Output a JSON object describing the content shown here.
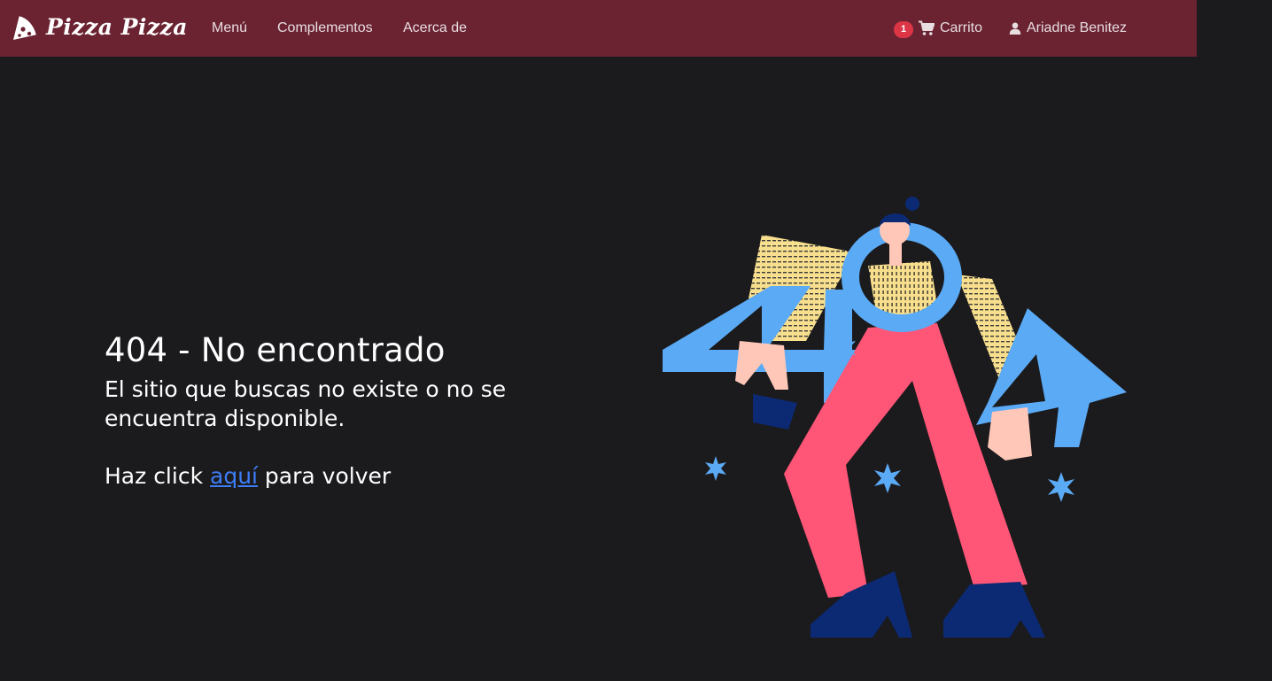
{
  "navbar": {
    "brand": "Pizza Pizza",
    "links": [
      "Menú",
      "Complementos",
      "Acerca de"
    ],
    "cart": {
      "count": "1",
      "label": "Carrito"
    },
    "user": {
      "name": "Ariadne Benitez"
    }
  },
  "page": {
    "title": "404 - No encontrado",
    "subtitle": "El sitio que buscas no existe o no se encuentra disponible.",
    "back_before": "Haz click ",
    "back_link": "aquí",
    "back_after": " para volver"
  },
  "colors": {
    "navbar": "#6b2332",
    "background": "#1b1a1d",
    "link": "#3d7df5",
    "badge": "#dc3545",
    "illustration_blue": "#5aaaf5",
    "illustration_yellow": "#f7df8e",
    "illustration_pink": "#ff5577",
    "illustration_navy": "#0b2a73"
  },
  "icons": [
    "pizza-slice-icon",
    "shopping-cart-icon",
    "user-icon"
  ]
}
